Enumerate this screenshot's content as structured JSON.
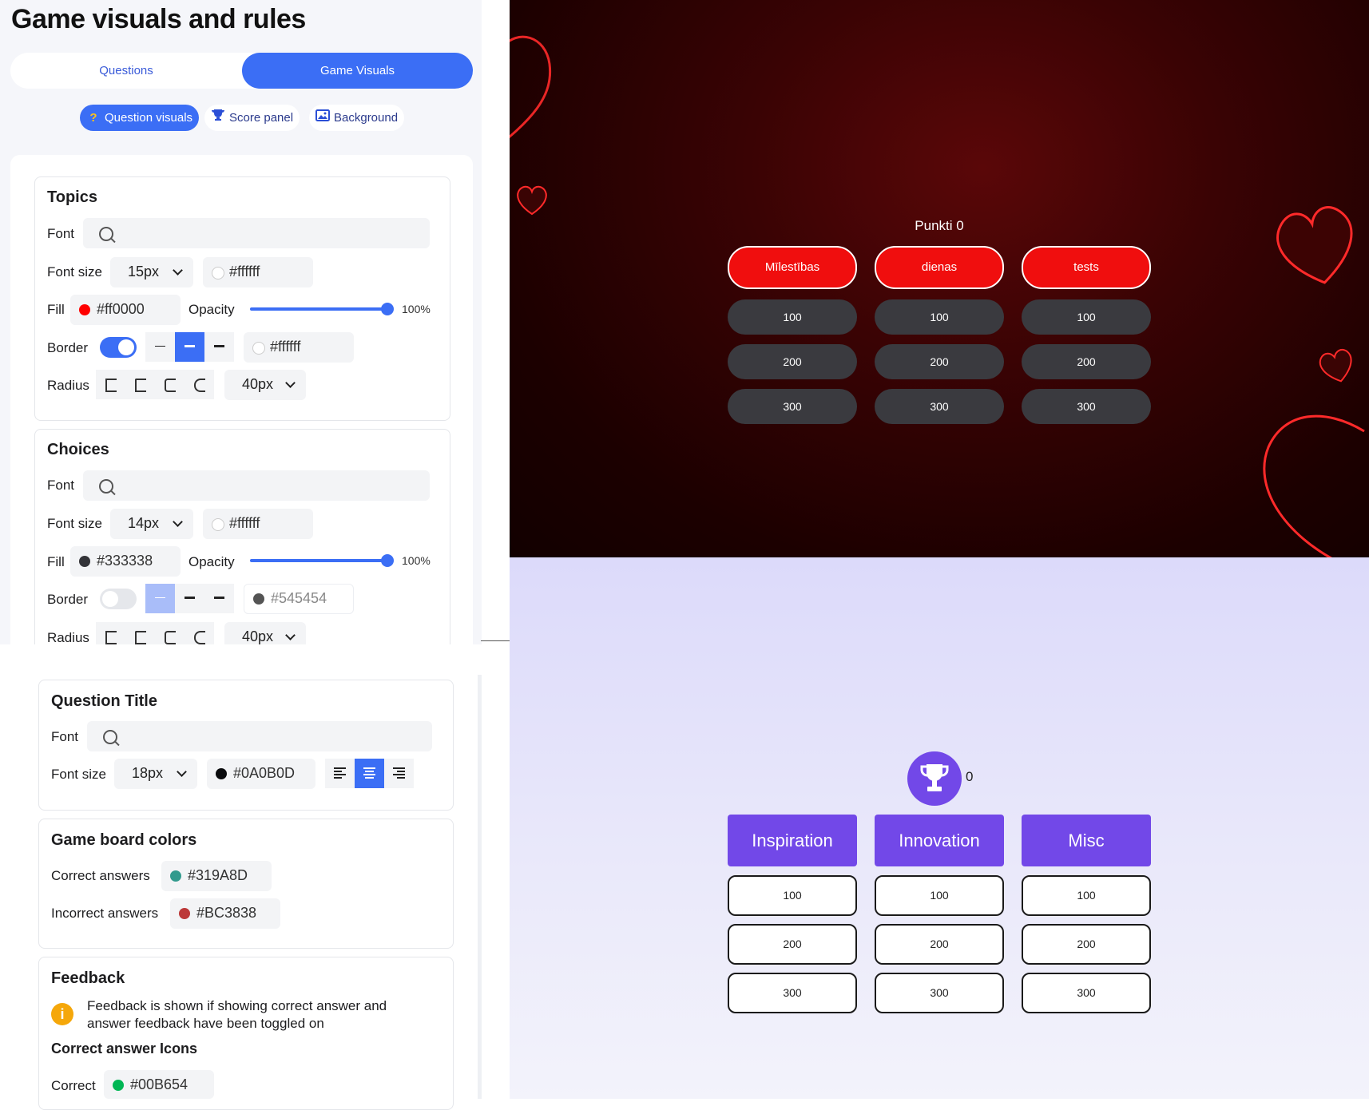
{
  "header": {
    "title": "Game visuals and rules"
  },
  "tabs": {
    "questions": "Questions",
    "game_visuals": "Game Visuals"
  },
  "subtabs": [
    {
      "label": "Question visuals",
      "icon": "question-icon"
    },
    {
      "label": "Score panel",
      "icon": "trophy-icon"
    },
    {
      "label": "Background",
      "icon": "image-icon"
    }
  ],
  "labels": {
    "font": "Font",
    "font_size": "Font size",
    "fill": "Fill",
    "opacity": "Opacity",
    "border": "Border",
    "radius": "Radius"
  },
  "topics": {
    "heading": "Topics",
    "font_size": "15px",
    "text_color": "#ffffff",
    "fill_color": "#ff0000",
    "opacity": "100%",
    "border_on": true,
    "border_color": "#ffffff",
    "radius": "40px"
  },
  "choices": {
    "heading": "Choices",
    "font_size": "14px",
    "text_color": "#ffffff",
    "fill_color": "#333338",
    "opacity": "100%",
    "border_on": false,
    "border_color": "#545454",
    "radius": "40px"
  },
  "question_title": {
    "heading": "Question Title",
    "font_size": "18px",
    "text_color": "#0A0B0D",
    "alignment": "center"
  },
  "board_colors": {
    "heading": "Game board colors",
    "correct_label": "Correct answers",
    "correct_color": "#319A8D",
    "incorrect_label": "Incorrect answers",
    "incorrect_color": "#BC3838"
  },
  "feedback": {
    "heading": "Feedback",
    "info": "Feedback is shown if showing correct answer and answer feedback have been toggled on",
    "icons_heading": "Correct answer Icons",
    "correct_label": "Correct",
    "correct_color": "#00B654"
  },
  "preview_red": {
    "score_text": "Punkti 0",
    "topics": [
      "Mīlestības",
      "dienas",
      "tests"
    ],
    "values": [
      "100",
      "200",
      "300"
    ]
  },
  "preview_purple": {
    "score": "0",
    "topics": [
      "Inspiration",
      "Innovation",
      "Misc"
    ],
    "values": [
      "100",
      "200",
      "300"
    ]
  }
}
